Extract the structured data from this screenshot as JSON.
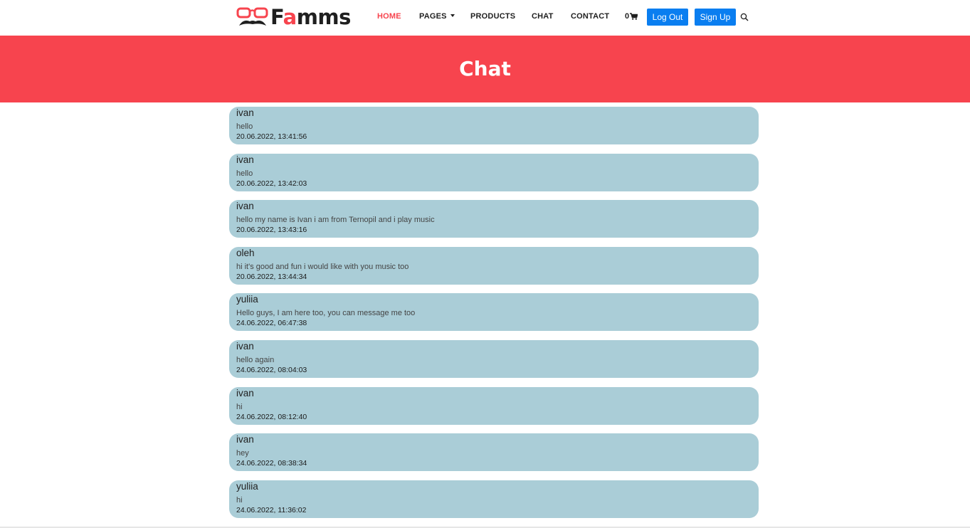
{
  "brand": {
    "name_first": "F",
    "name_accent": "a",
    "name_rest": "mms"
  },
  "nav": {
    "home": "HOME",
    "pages": "PAGES",
    "products": "PRODUCTS",
    "chat": "CHAT",
    "contact": "CONTACT",
    "cart_count": "0",
    "logout": "Log Out",
    "signup": "Sign Up"
  },
  "hero": {
    "title": "Chat"
  },
  "messages": [
    {
      "user": "ivan",
      "text": "hello",
      "time": "20.06.2022, 13:41:56"
    },
    {
      "user": "ivan",
      "text": "hello",
      "time": "20.06.2022, 13:42:03"
    },
    {
      "user": "ivan",
      "text": "hello my name is Ivan i am from Ternopil and i play music",
      "time": "20.06.2022, 13:43:16"
    },
    {
      "user": "oleh",
      "text": "hi it's good and fun i would like with you music too",
      "time": "20.06.2022, 13:44:34"
    },
    {
      "user": "yuliia",
      "text": "Hello guys, I am here too, you can message me too",
      "time": "24.06.2022, 06:47:38"
    },
    {
      "user": "ivan",
      "text": "hello again",
      "time": "24.06.2022, 08:04:03"
    },
    {
      "user": "ivan",
      "text": "hi",
      "time": "24.06.2022, 08:12:40"
    },
    {
      "user": "ivan",
      "text": "hey",
      "time": "24.06.2022, 08:38:34"
    },
    {
      "user": "yuliia",
      "text": "hi",
      "time": "24.06.2022, 11:36:02"
    }
  ],
  "colors": {
    "accent": "#f7444e",
    "button": "#0a7ef0",
    "bubble": "#aacdd7"
  },
  "icons": {
    "logo": "glasses-mustache-icon",
    "cart": "cart-icon",
    "search": "search-icon",
    "pages_dropdown": "caret-down-icon"
  }
}
